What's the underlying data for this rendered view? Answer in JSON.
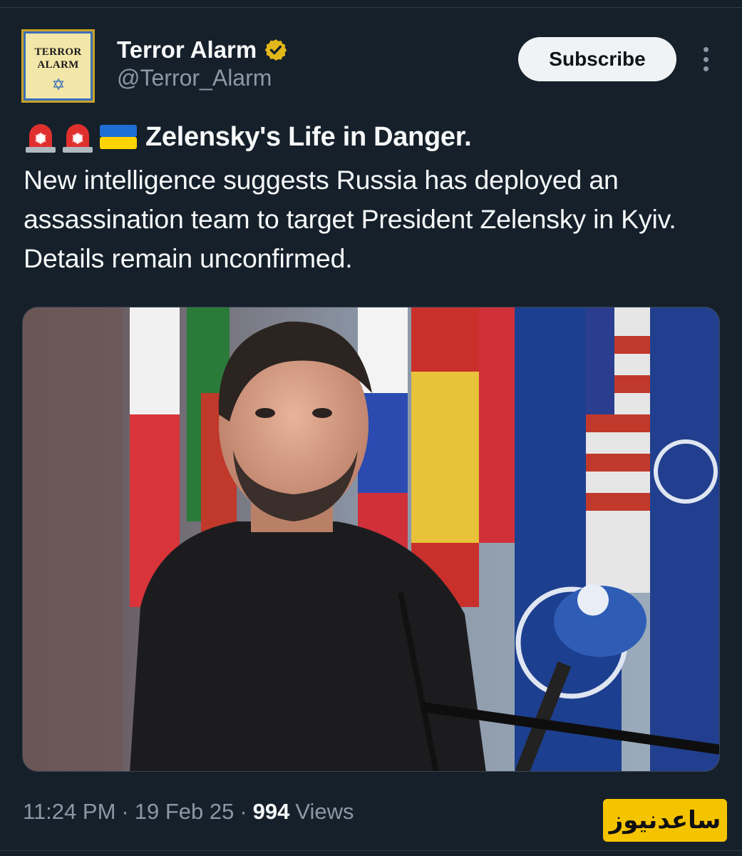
{
  "author": {
    "avatar_text_line1": "TERROR",
    "avatar_text_line2": "ALARM",
    "display_name": "Terror Alarm",
    "handle": "@Terror_Alarm",
    "verified_badge": "gold-verified-icon"
  },
  "actions": {
    "subscribe_label": "Subscribe",
    "more_icon": "more-vertical-icon"
  },
  "tweet": {
    "headline_emojis": [
      "police-light-icon",
      "police-light-icon",
      "ukraine-flag-icon"
    ],
    "headline": "Zelensky's Life in Danger.",
    "body": "New intelligence suggests Russia has deployed an assassination team to target President Zelensky in Kyiv. Details remain unconfirmed.",
    "media_alt": "photo"
  },
  "meta": {
    "time": "11:24 PM",
    "separator": "·",
    "date": "19 Feb 25",
    "views_count": "994",
    "views_label": "Views"
  },
  "watermark": {
    "text": "ساعدنیوز"
  },
  "colors": {
    "background": "#15202b",
    "text_primary": "#f7f9f9",
    "text_secondary": "#8b98a5",
    "watermark_bg": "#f5c400"
  }
}
